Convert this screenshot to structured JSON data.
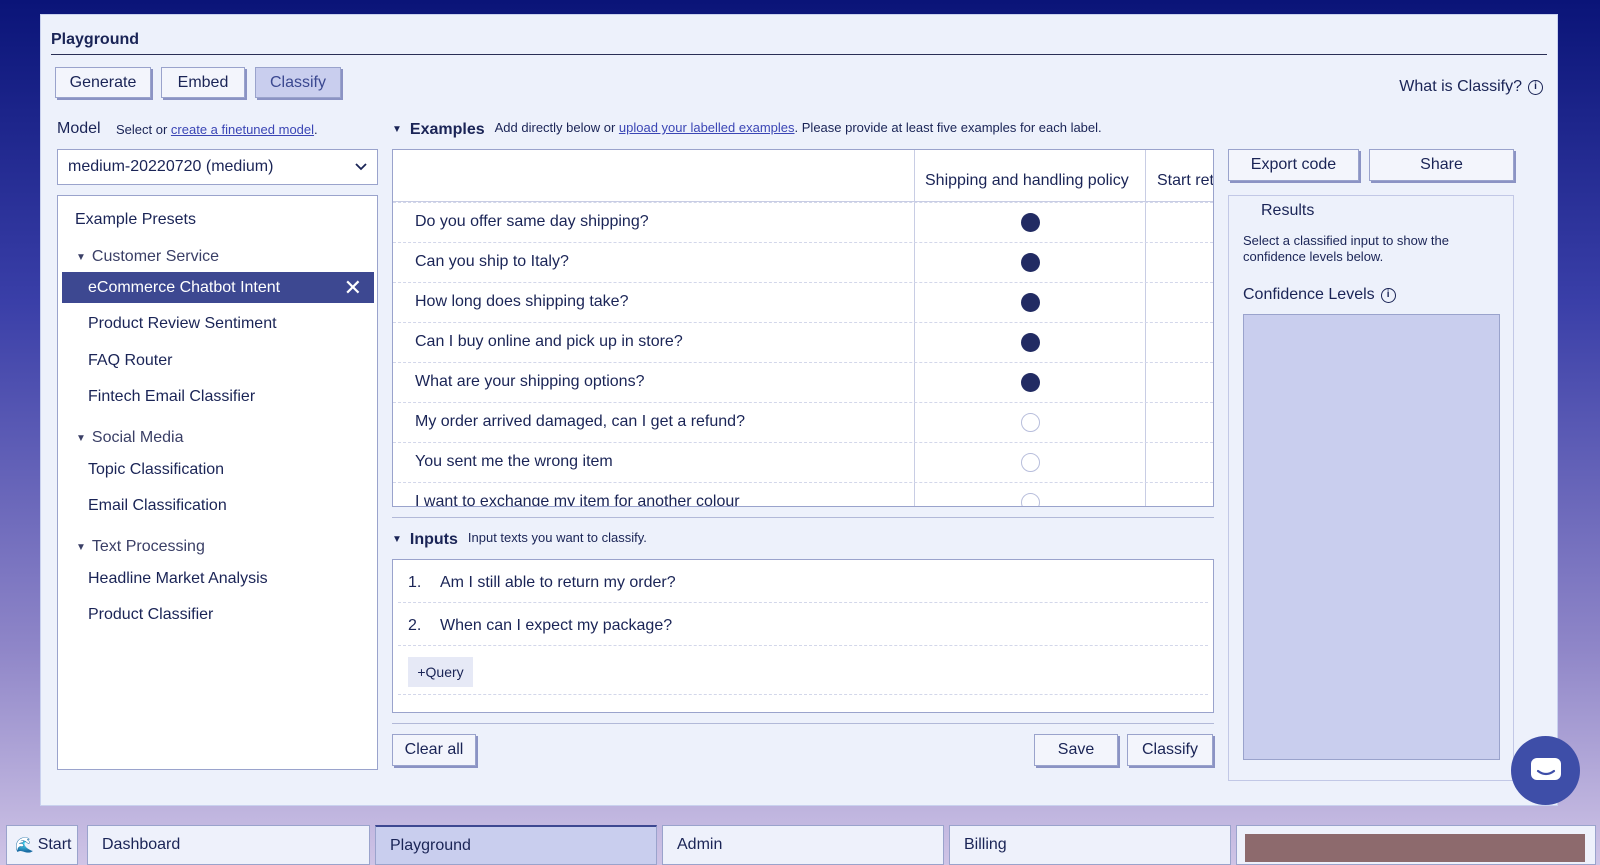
{
  "window": {
    "title": "Playground"
  },
  "mode_tabs": [
    {
      "label": "Generate"
    },
    {
      "label": "Embed"
    },
    {
      "label": "Classify"
    }
  ],
  "what_is": "What is Classify?",
  "model": {
    "label": "Model",
    "hint_prefix": "Select or ",
    "hint_link": "create a finetuned model",
    "hint_suffix": ".",
    "selected": "medium-20220720 (medium)"
  },
  "presets": {
    "title": "Example Presets",
    "groups": [
      {
        "name": "Customer Service",
        "items": [
          "eCommerce Chatbot Intent",
          "Product Review Sentiment",
          "FAQ Router",
          "Fintech Email Classifier"
        ]
      },
      {
        "name": "Social Media",
        "items": [
          "Topic Classification",
          "Email Classification"
        ]
      },
      {
        "name": "Text Processing",
        "items": [
          "Headline Market Analysis",
          "Product Classifier"
        ]
      }
    ]
  },
  "examples": {
    "heading": "Examples",
    "hint_prefix": "Add directly below or ",
    "hint_link": "upload your labelled examples",
    "hint_suffix": ". Please provide at least five examples for each label.",
    "columns": [
      "Shipping and handling policy",
      "Start ret"
    ],
    "rows": [
      {
        "text": "Do you offer same day shipping?",
        "checked": true
      },
      {
        "text": "Can you ship to Italy?",
        "checked": true
      },
      {
        "text": "How long does shipping take?",
        "checked": true
      },
      {
        "text": "Can I buy online and pick up in store?",
        "checked": true
      },
      {
        "text": "What are your shipping options?",
        "checked": true
      },
      {
        "text": "My order arrived damaged, can I get a refund?",
        "checked": false
      },
      {
        "text": "You sent me the wrong item",
        "checked": false
      },
      {
        "text": "I want to exchange my item for another colour",
        "checked": false
      }
    ]
  },
  "inputs": {
    "heading": "Inputs",
    "hint": "Input texts you want to classify.",
    "items": [
      {
        "num": "1.",
        "text": "Am I still able to return my order?"
      },
      {
        "num": "2.",
        "text": "When can I expect my package?"
      }
    ],
    "add_query": "+Query"
  },
  "actions": {
    "clear_all": "Clear all",
    "save": "Save",
    "classify": "Classify",
    "export_code": "Export code",
    "share": "Share"
  },
  "results": {
    "title": "Results",
    "hint": "Select a classified input to show the confidence levels below.",
    "confidence_label": "Confidence Levels"
  },
  "taskbar": {
    "start": "Start",
    "items": [
      "Dashboard",
      "Playground",
      "Admin",
      "Billing"
    ]
  }
}
